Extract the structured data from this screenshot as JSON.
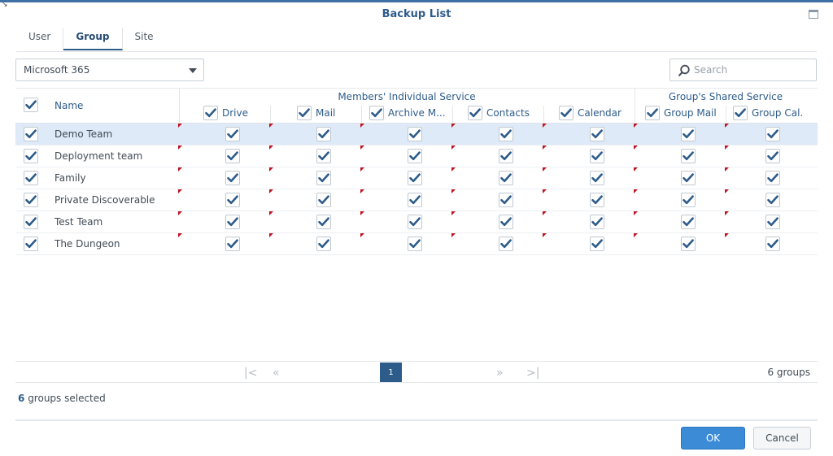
{
  "window": {
    "title": "Backup List",
    "accent_color": "#2e5c8a",
    "dirty_marker_color": "#c1121f"
  },
  "tabs": [
    {
      "label": "User",
      "active": false
    },
    {
      "label": "Group",
      "active": true
    },
    {
      "label": "Site",
      "active": false
    }
  ],
  "service_select": {
    "value": "Microsoft 365"
  },
  "search": {
    "placeholder": "Search",
    "value": ""
  },
  "grid": {
    "name_header": "Name",
    "group_individual": "Members' Individual Service",
    "group_shared": "Group's Shared Service",
    "columns": [
      {
        "key": "drive",
        "label": "Drive"
      },
      {
        "key": "mail",
        "label": "Mail"
      },
      {
        "key": "archive",
        "label": "Archive M..."
      },
      {
        "key": "contacts",
        "label": "Contacts"
      },
      {
        "key": "calendar",
        "label": "Calendar"
      },
      {
        "key": "group_mail",
        "label": "Group Mail"
      },
      {
        "key": "group_cal",
        "label": "Group Cal."
      }
    ],
    "rows": [
      {
        "name": "Demo Team",
        "selected": true,
        "checked": true
      },
      {
        "name": "Deployment team",
        "selected": false,
        "checked": true
      },
      {
        "name": "Family",
        "selected": false,
        "checked": true
      },
      {
        "name": "Private Discoverable",
        "selected": false,
        "checked": true
      },
      {
        "name": "Test Team",
        "selected": false,
        "checked": true
      },
      {
        "name": "The Dungeon",
        "selected": false,
        "checked": true
      }
    ]
  },
  "pager": {
    "current_page": "1",
    "total_label": "6 groups"
  },
  "status": {
    "count": "6",
    "text": "groups selected"
  },
  "buttons": {
    "ok": "OK",
    "cancel": "Cancel"
  }
}
